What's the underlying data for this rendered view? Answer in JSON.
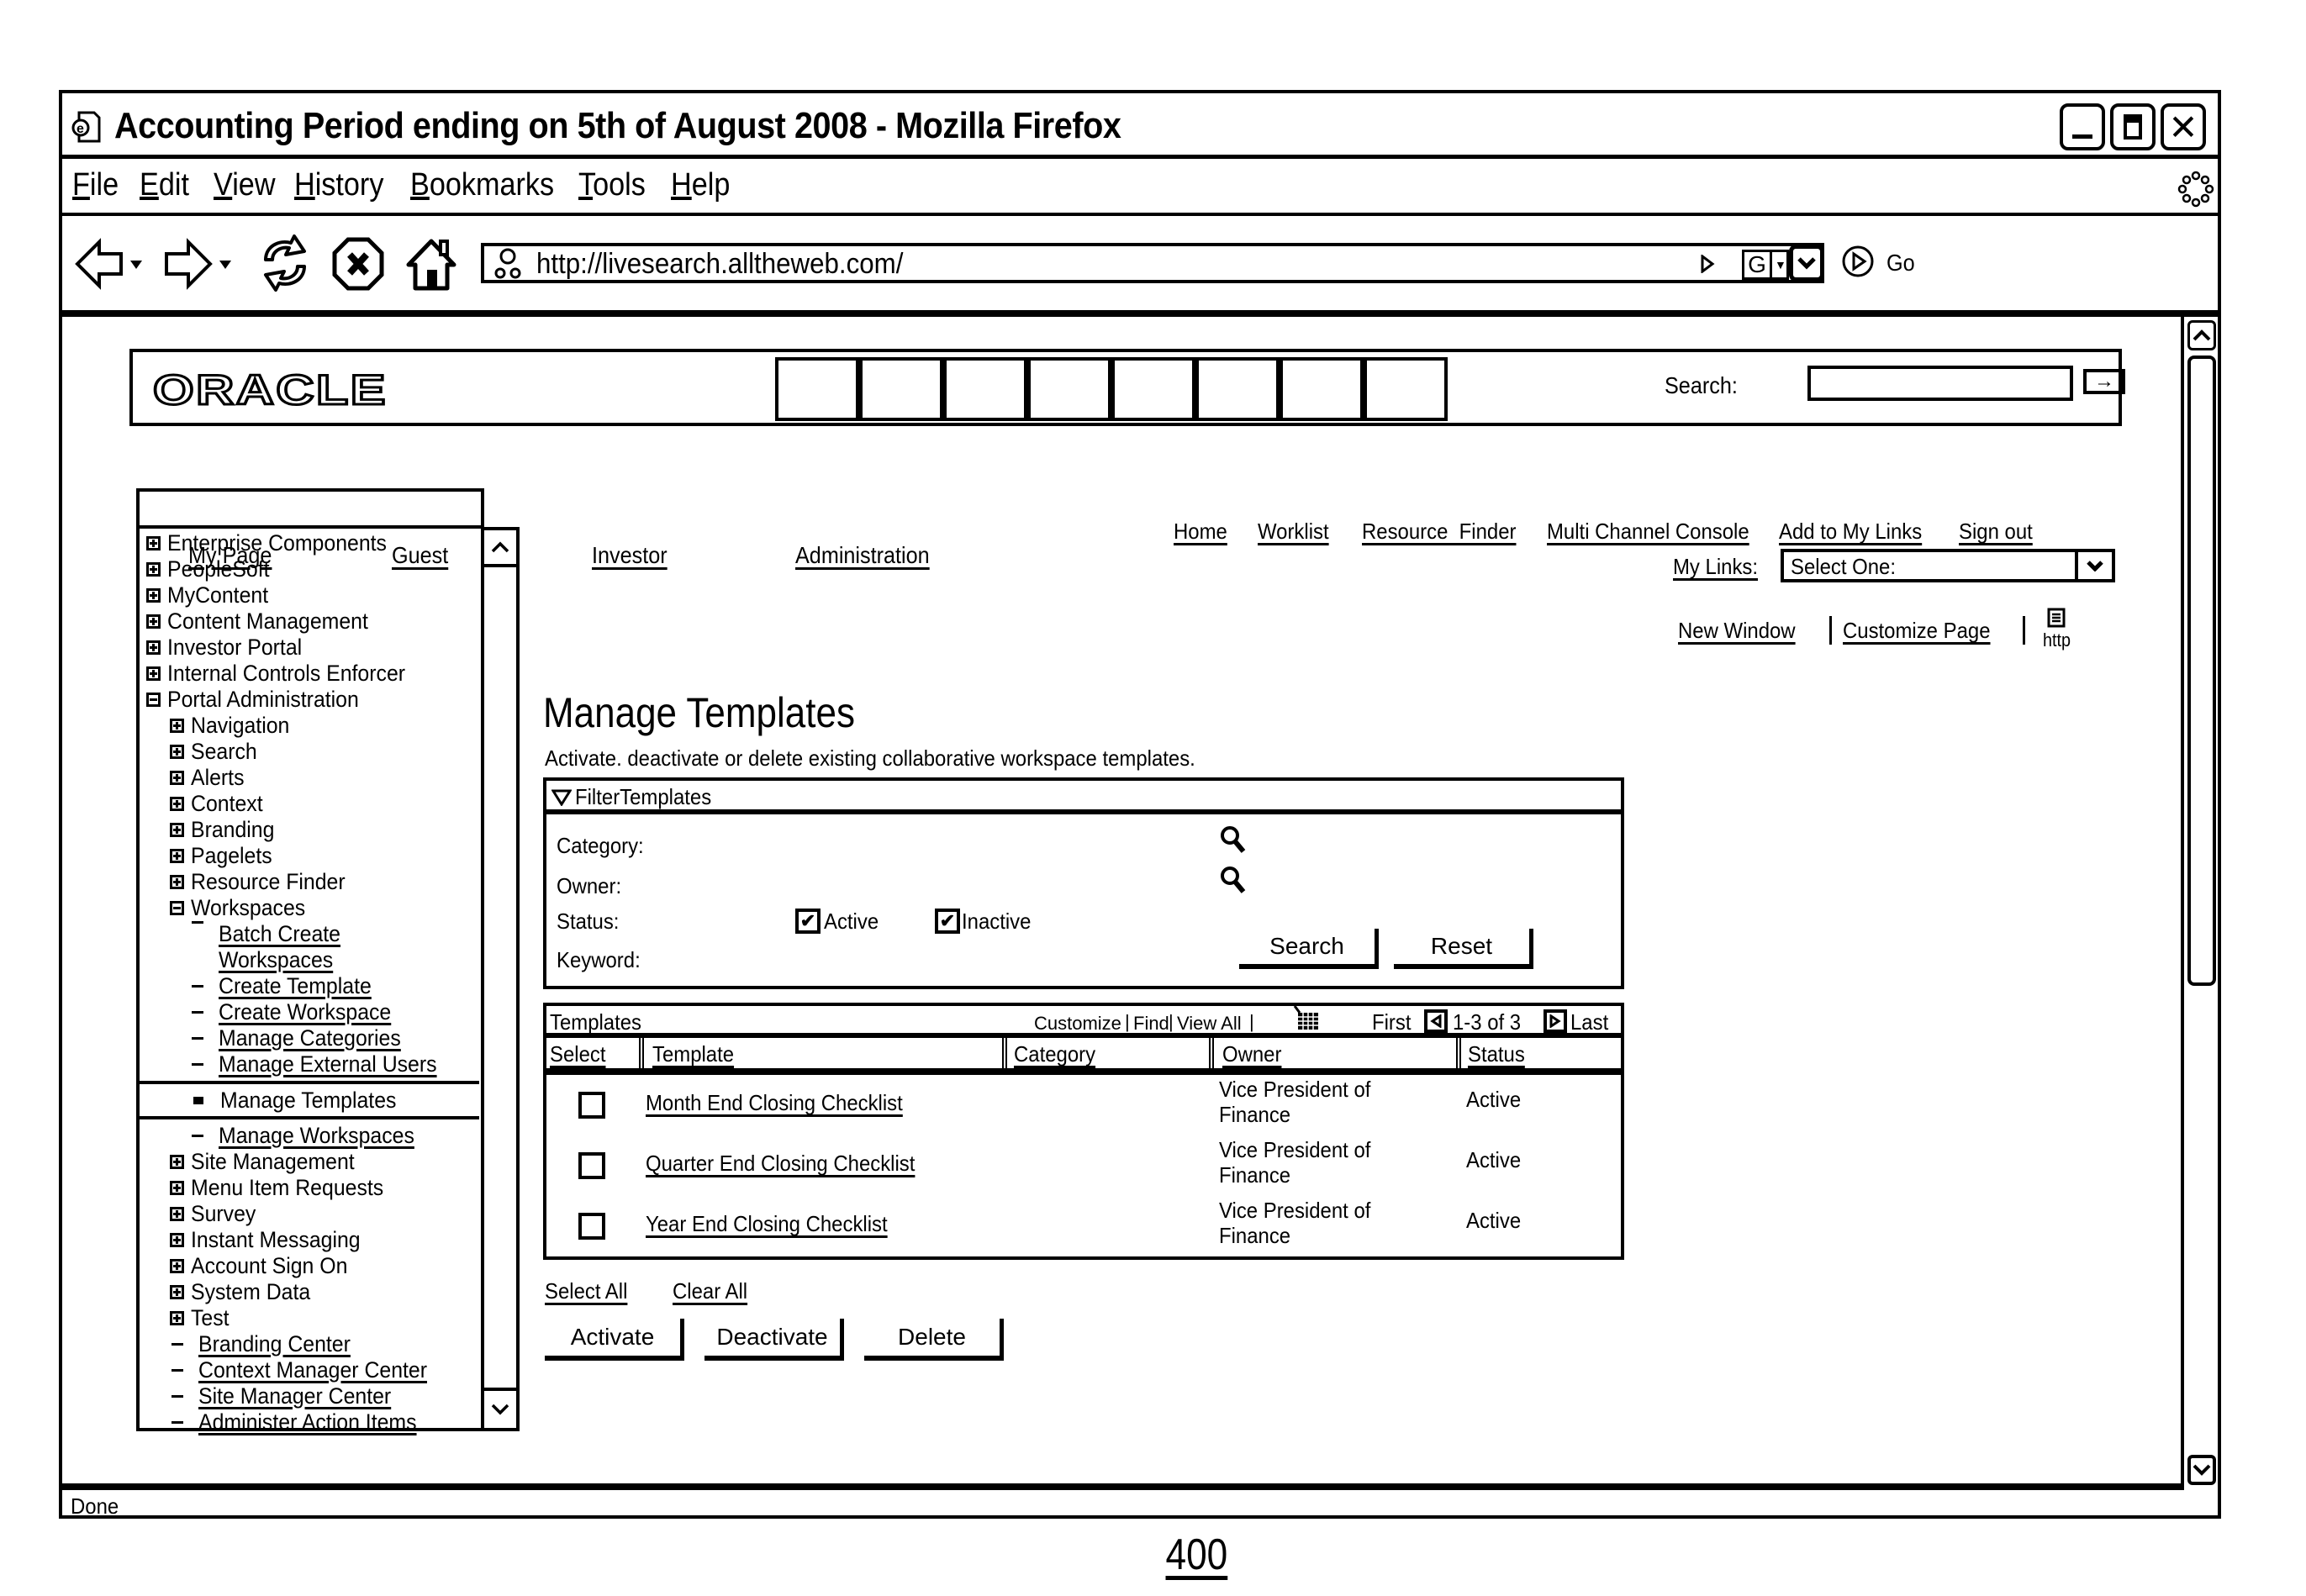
{
  "window": {
    "title": "Accounting Period ending on 5th of August 2008 - Mozilla Firefox",
    "controls": {
      "minimize": "_",
      "maximize": "▭",
      "close": "X"
    }
  },
  "menubar": {
    "items": [
      {
        "label": "File",
        "mnemonic": "F",
        "rest": "ile"
      },
      {
        "label": "Edit",
        "mnemonic": "E",
        "rest": "dit"
      },
      {
        "label": "View",
        "mnemonic": "V",
        "rest": "iew"
      },
      {
        "label": "History",
        "mnemonic": "H",
        "rest": "istory"
      },
      {
        "label": "Bookmarks",
        "mnemonic": "B",
        "rest": "ookmarks"
      },
      {
        "label": "Tools",
        "mnemonic": "T",
        "rest": "ools"
      },
      {
        "label": "Help",
        "mnemonic": "H",
        "rest": "elp"
      }
    ]
  },
  "navbar": {
    "url": "http://livesearch.alltheweb.com/",
    "search_engine": "G",
    "go_label": "Go"
  },
  "portal": {
    "logo": "ORACLE",
    "search_label": "Search:",
    "search_value": "",
    "tabs": [
      "My Page",
      "Guest",
      "Investor",
      "Administration"
    ],
    "top_links": [
      "Home",
      "Worklist",
      "Resource  Finder",
      "Multi Channel Console",
      "Add to My Links",
      "Sign out"
    ],
    "my_links_label": "My Links:",
    "my_links_selected": "Select One:",
    "page_links": [
      "New Window",
      "Customize Page"
    ],
    "http_label": "http"
  },
  "tree": {
    "items": [
      {
        "label": "Enterprise Components",
        "type": "plus",
        "level": 0
      },
      {
        "label": "PeopleSoft",
        "type": "plus",
        "level": 0
      },
      {
        "label": "MyContent",
        "type": "plus",
        "level": 0
      },
      {
        "label": "Content Management",
        "type": "plus",
        "level": 0
      },
      {
        "label": "Investor Portal",
        "type": "plus",
        "level": 0
      },
      {
        "label": "Internal Controls Enforcer",
        "type": "plus",
        "level": 0
      },
      {
        "label": "Portal Administration",
        "type": "minus",
        "level": 0
      },
      {
        "label": "Navigation",
        "type": "plus",
        "level": 1
      },
      {
        "label": "Search",
        "type": "plus",
        "level": 1
      },
      {
        "label": "Alerts",
        "type": "plus",
        "level": 1
      },
      {
        "label": "Context",
        "type": "plus",
        "level": 1
      },
      {
        "label": "Branding",
        "type": "plus",
        "level": 1
      },
      {
        "label": "Pagelets",
        "type": "plus",
        "level": 1
      },
      {
        "label": "Resource Finder",
        "type": "plus",
        "level": 1
      },
      {
        "label": "Workspaces",
        "type": "minus",
        "level": 1
      },
      {
        "label": "Batch Create Workspaces",
        "type": "link",
        "level": 2
      },
      {
        "label": "Create Template",
        "type": "link",
        "level": 2
      },
      {
        "label": "Create Workspace",
        "type": "link",
        "level": 2
      },
      {
        "label": "Manage Categories",
        "type": "link",
        "level": 2
      },
      {
        "label": "Manage External Users",
        "type": "link",
        "level": 2
      },
      {
        "label": "Manage Templates",
        "type": "selected",
        "level": 2
      },
      {
        "label": "Manage Workspaces",
        "type": "link",
        "level": 2
      },
      {
        "label": "Site Management",
        "type": "plus",
        "level": 1
      },
      {
        "label": "Menu Item Requests",
        "type": "plus",
        "level": 1
      },
      {
        "label": "Survey",
        "type": "plus",
        "level": 1
      },
      {
        "label": "Instant Messaging",
        "type": "plus",
        "level": 1
      },
      {
        "label": "Account Sign On",
        "type": "plus",
        "level": 1
      },
      {
        "label": "System Data",
        "type": "plus",
        "level": 1
      },
      {
        "label": "Test",
        "type": "plus",
        "level": 1
      },
      {
        "label": "Branding Center",
        "type": "link",
        "level": 1
      },
      {
        "label": "Context Manager Center",
        "type": "link",
        "level": 1
      },
      {
        "label": "Site Manager Center",
        "type": "link",
        "level": 1
      },
      {
        "label": "Administer Action Items",
        "type": "link",
        "level": 1
      }
    ]
  },
  "main": {
    "title": "Manage Templates",
    "description": "Activate. deactivate or delete existing collaborative workspace templates.",
    "filter": {
      "header": "FilterTemplates",
      "category_label": "Category:",
      "owner_label": "Owner:",
      "status_label": "Status:",
      "keyword_label": "Keyword:",
      "status_active": {
        "label": "Active",
        "checked": true
      },
      "status_inactive": {
        "label": "Inactive",
        "checked": true
      },
      "search_button": "Search",
      "reset_button": "Reset"
    },
    "grid": {
      "title": "Templates",
      "customize": "Customize",
      "find": "Find",
      "view_all": "View All",
      "first": "First",
      "range": "1-3 of 3",
      "last": "Last",
      "columns": [
        "Select",
        "Template",
        "Category",
        "Owner",
        "Status"
      ],
      "rows": [
        {
          "selected": false,
          "template": "Month End Closing Checklist",
          "category": "",
          "owner_line1": "Vice President of",
          "owner_line2": "Finance",
          "status": "Active"
        },
        {
          "selected": false,
          "template": "Quarter End Closing Checklist",
          "category": "",
          "owner_line1": "Vice President of",
          "owner_line2": "Finance",
          "status": "Active"
        },
        {
          "selected": false,
          "template": "Year End Closing Checklist",
          "category": "",
          "owner_line1": "Vice President of",
          "owner_line2": "Finance",
          "status": "Active"
        }
      ]
    },
    "select_all": "Select All",
    "clear_all": "Clear All",
    "actions": [
      "Activate",
      "Deactivate",
      "Delete"
    ]
  },
  "statusbar": {
    "text": "Done"
  },
  "figure_label": "400"
}
